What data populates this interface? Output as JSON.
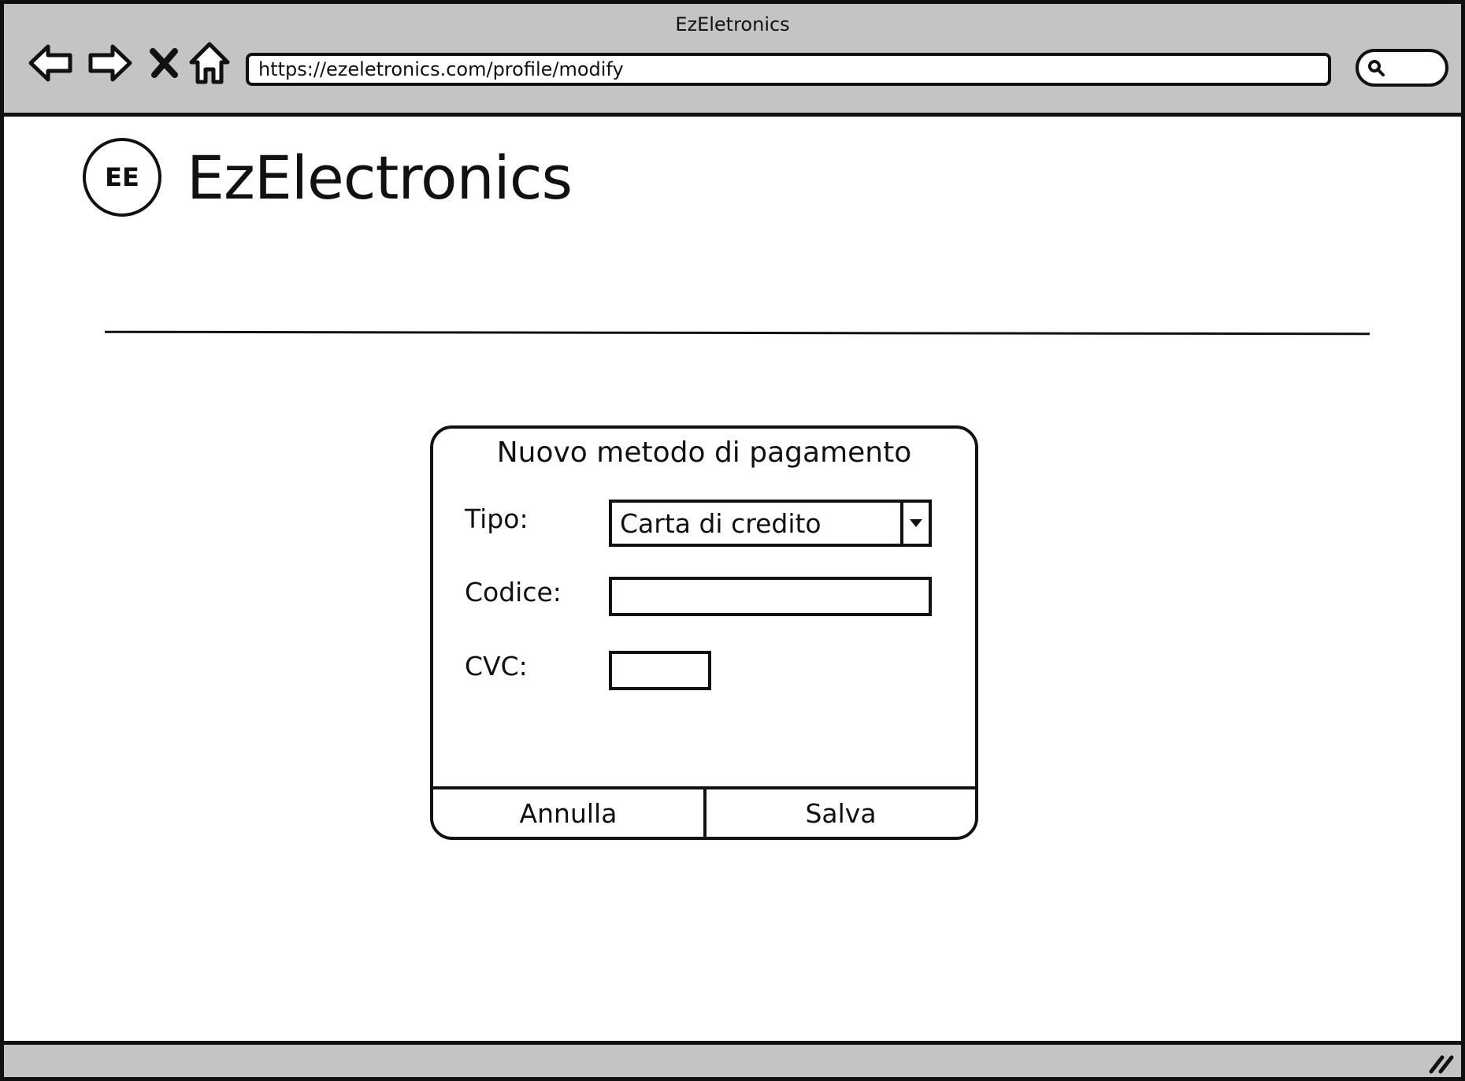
{
  "window": {
    "title": "EzEletronics"
  },
  "toolbar": {
    "back_icon": "arrow-left-icon",
    "forward_icon": "arrow-right-icon",
    "stop_icon": "close-icon",
    "home_icon": "home-icon",
    "address": "https://ezeletronics.com/profile/modify",
    "search_icon": "search-icon"
  },
  "header": {
    "logo_text": "EE",
    "brand_name": "EzElectronics"
  },
  "dialog": {
    "title": "Nuovo metodo di pagamento",
    "fields": {
      "tipo": {
        "label": "Tipo:",
        "selected": "Carta di credito"
      },
      "codice": {
        "label": "Codice:",
        "value": ""
      },
      "cvc": {
        "label": "CVC:",
        "value": ""
      }
    },
    "buttons": {
      "cancel": "Annulla",
      "save": "Salva"
    }
  },
  "colors": {
    "chrome": "#c4c4c4",
    "stroke": "#111111",
    "background": "#ffffff"
  }
}
